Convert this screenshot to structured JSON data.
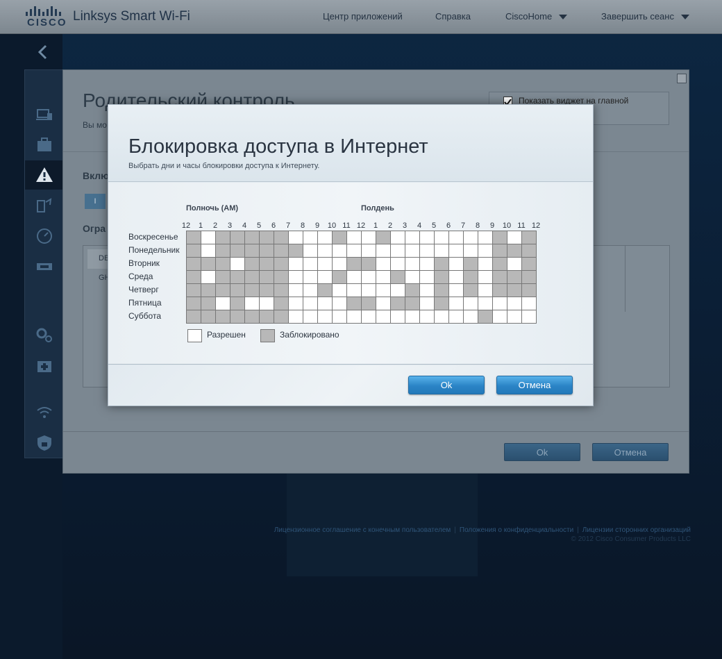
{
  "header": {
    "logo_text": "CISCO",
    "brand": "Linksys Smart Wi-Fi",
    "nav": {
      "apps": "Центр приложений",
      "help": "Справка",
      "account": "CiscoHome",
      "logout": "Завершить сеанс"
    }
  },
  "background_panel": {
    "title": "Родительский контроль",
    "subtitle": "Вы мо",
    "show_widget_label": "Показать виджет на главной",
    "show_widget_checked": true,
    "enable_label": "Вклю",
    "toggle_text": "I",
    "restrict_label": "Огра",
    "list_item_1": "DE",
    "list_item_2": "GH",
    "ok_label": "Ok",
    "cancel_label": "Отмена"
  },
  "footer": {
    "links": [
      "Лицензионное соглашение с конечным пользователем",
      "Положения о конфиденциальности",
      "Лицензии сторонних организаций"
    ],
    "copyright": "© 2012 Cisco Consumer Products LLC"
  },
  "modal": {
    "title": "Блокировка доступа в Интернет",
    "subtitle": "Выбрать дни и часы блокировки доступа к Интернету.",
    "label_midnight": "Полночь (AM)",
    "label_noon": "Полдень",
    "hour_labels": [
      "12",
      "1",
      "2",
      "3",
      "4",
      "5",
      "6",
      "7",
      "8",
      "9",
      "10",
      "11",
      "12",
      "1",
      "2",
      "3",
      "4",
      "5",
      "6",
      "7",
      "8",
      "9",
      "10",
      "11",
      "12"
    ],
    "days": [
      "Воскресенье",
      "Понедельник",
      "Вторник",
      "Среда",
      "Четверг",
      "Пятница",
      "Суббота"
    ],
    "schedule": [
      [
        1,
        0,
        1,
        1,
        1,
        1,
        1,
        0,
        0,
        0,
        1,
        0,
        0,
        1,
        0,
        0,
        0,
        0,
        0,
        0,
        0,
        1,
        0,
        1
      ],
      [
        1,
        0,
        1,
        1,
        1,
        1,
        1,
        1,
        0,
        0,
        0,
        0,
        0,
        0,
        0,
        0,
        0,
        0,
        0,
        0,
        0,
        1,
        1,
        1
      ],
      [
        1,
        1,
        1,
        0,
        1,
        1,
        1,
        0,
        0,
        0,
        0,
        1,
        1,
        0,
        0,
        0,
        0,
        1,
        0,
        1,
        0,
        1,
        0,
        1
      ],
      [
        1,
        0,
        1,
        1,
        1,
        1,
        1,
        0,
        0,
        0,
        1,
        0,
        0,
        0,
        1,
        0,
        0,
        1,
        0,
        1,
        0,
        1,
        1,
        1
      ],
      [
        1,
        1,
        1,
        1,
        1,
        1,
        1,
        0,
        0,
        1,
        0,
        0,
        0,
        0,
        0,
        1,
        0,
        1,
        0,
        1,
        0,
        1,
        1,
        1
      ],
      [
        1,
        1,
        0,
        1,
        0,
        0,
        1,
        0,
        0,
        0,
        0,
        1,
        1,
        0,
        1,
        1,
        0,
        1,
        0,
        0,
        0,
        0,
        0,
        0
      ],
      [
        1,
        1,
        1,
        1,
        1,
        1,
        1,
        0,
        0,
        0,
        0,
        0,
        0,
        0,
        0,
        0,
        0,
        0,
        0,
        0,
        1,
        0,
        0,
        0
      ]
    ],
    "legend_allowed": "Разрешен",
    "legend_blocked": "Заблокировано",
    "ok_label": "Ok",
    "cancel_label": "Отмена"
  },
  "colors": {
    "blocked_cell": "#b8b8b8",
    "allowed_cell": "#ffffff",
    "accent_button": "#2b84c6"
  }
}
